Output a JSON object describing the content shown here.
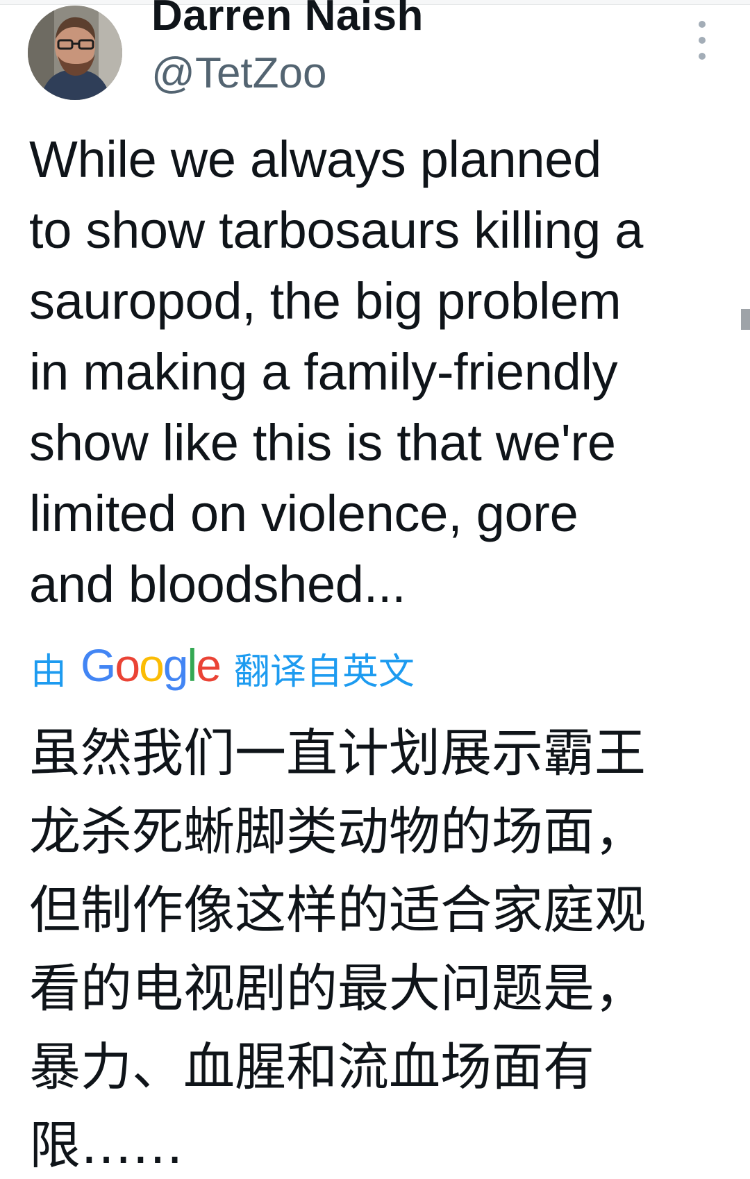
{
  "tweet": {
    "author": {
      "display_name": "Darren Naish",
      "handle": "@TetZoo",
      "avatar_icon": "user-avatar-photo"
    },
    "more_icon": "more-vertical-icon",
    "text": "While we always planned\nto show tarbosaurs killing a\nsauropod, the big problem\nin making a family-friendly\nshow like this is that we're\nlimited on violence, gore\nand bloodshed...",
    "translation": {
      "prefix": "由",
      "brand": "Google",
      "brand_colors": [
        "#4285f4",
        "#ea4335",
        "#fbbc05",
        "#4285f4",
        "#34a853",
        "#ea4335"
      ],
      "suffix": "翻译自英文",
      "text": "虽然我们一直计划展示霸王\n龙杀死蜥脚类动物的场面，\n但制作像这样的适合家庭观\n看的电视剧的最大问题是，\n暴力、血腥和流血场面有\n限……"
    }
  },
  "colors": {
    "text": "#0f1419",
    "secondary": "#536471",
    "link": "#1d9bf0"
  }
}
